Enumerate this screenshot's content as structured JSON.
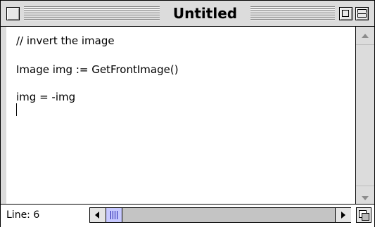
{
  "window": {
    "title": "Untitled"
  },
  "editor": {
    "lines": [
      "// invert the image",
      "Image img := GetFrontImage()",
      "img = -img"
    ]
  },
  "status": {
    "line_label": "Line: 6"
  },
  "icons": {
    "close_box": "close-box-icon",
    "zoom_box": "zoom-box-icon",
    "collapse_box": "collapse-box-icon",
    "scroll_up": "scroll-up-arrow-icon",
    "scroll_down": "scroll-down-arrow-icon",
    "scroll_left": "scroll-left-arrow-icon",
    "scroll_right": "scroll-right-arrow-icon",
    "grow_box": "grow-box-icon"
  },
  "colors": {
    "chrome": "#dcdcdc",
    "thumb": "#c7c9ff",
    "thumb_grip": "#1a1aa8"
  }
}
